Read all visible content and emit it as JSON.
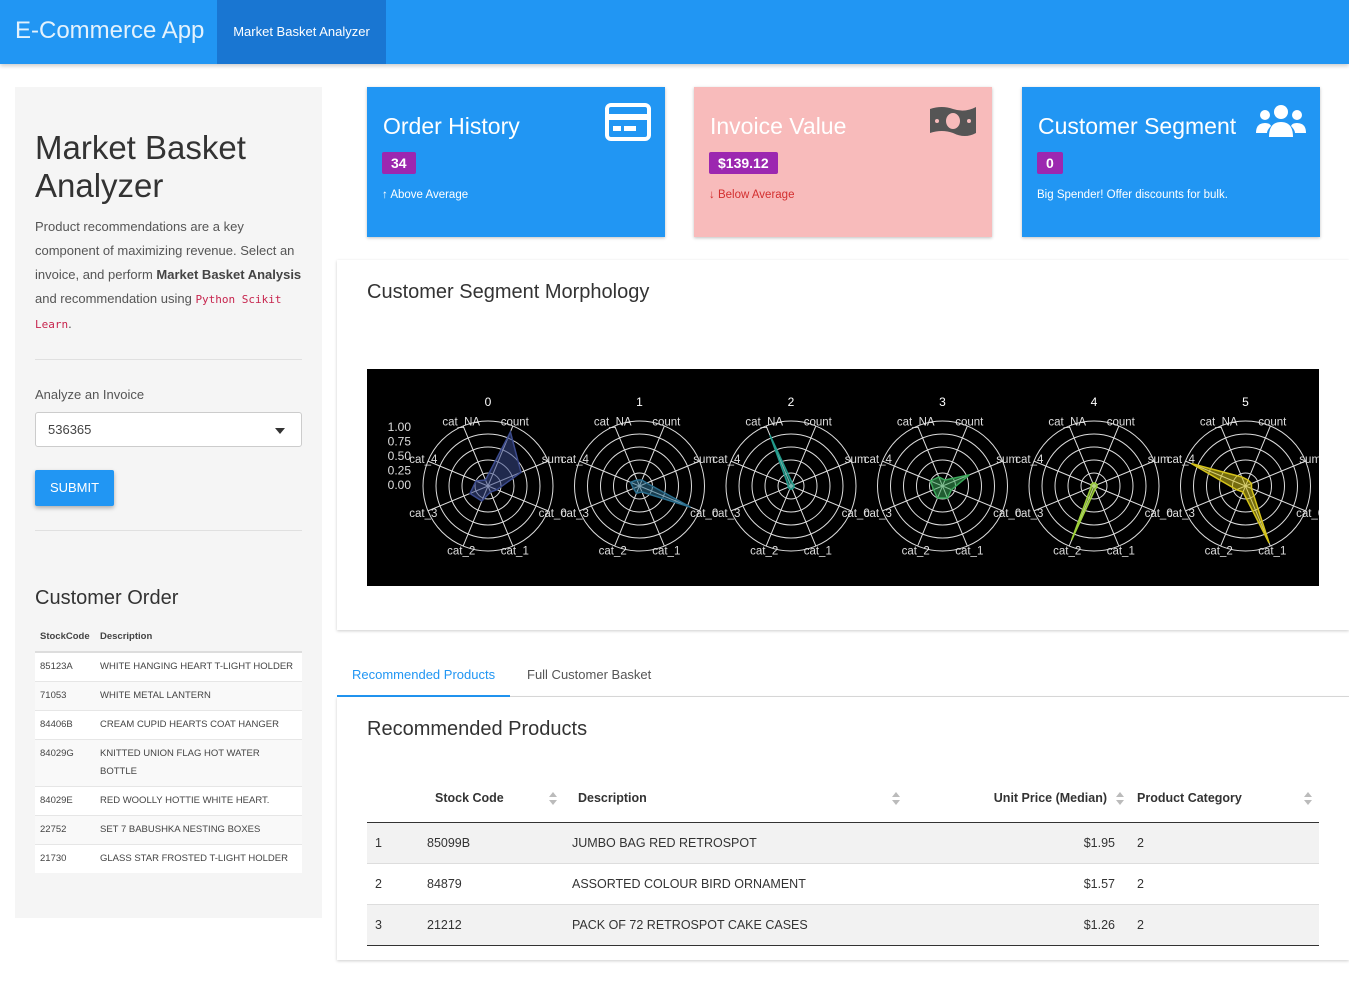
{
  "navbar": {
    "brand": "E-Commerce App",
    "tab": "Market Basket Analyzer",
    "color": "#2196f3"
  },
  "sidebar": {
    "title": "Market Basket Analyzer",
    "desc_1": "Product recommendations are a key component of maximizing revenue. Select an invoice, and perform ",
    "desc_bold": "Market Basket Analysis",
    "desc_2": " and recommendation using ",
    "desc_code": "Python Scikit Learn",
    "desc_3": ".",
    "select_label": "Analyze an Invoice",
    "select_value": "536365",
    "submit_label": "SUBMIT",
    "order_title": "Customer Order",
    "order_columns": [
      "StockCode",
      "Description"
    ],
    "order_rows": [
      [
        "85123A",
        "WHITE HANGING HEART T-LIGHT HOLDER"
      ],
      [
        "71053",
        "WHITE METAL LANTERN"
      ],
      [
        "84406B",
        "CREAM CUPID HEARTS COAT HANGER"
      ],
      [
        "84029G",
        "KNITTED UNION FLAG HOT WATER BOTTLE"
      ],
      [
        "84029E",
        "RED WOOLLY HOTTIE WHITE HEART."
      ],
      [
        "22752",
        "SET 7 BABUSHKA NESTING BOXES"
      ],
      [
        "21730",
        "GLASS STAR FROSTED T-LIGHT HOLDER"
      ]
    ]
  },
  "value_boxes": [
    {
      "title": "Order History",
      "value": "34",
      "subtitle": "Above Average",
      "arrow": "↑",
      "icon": "credit-card-icon",
      "bg": "#2196f3",
      "fg": "#ffffff"
    },
    {
      "title": "Invoice Value",
      "value": "$139.12",
      "subtitle": "Below Average",
      "arrow": "↓",
      "icon": "money-bill-icon",
      "bg": "#f8bbbb",
      "fg": "#ffffff"
    },
    {
      "title": "Customer Segment",
      "value": "0",
      "subtitle": "Big Spender! Offer discounts for bulk.",
      "arrow": "",
      "icon": "users-icon",
      "bg": "#2196f3",
      "fg": "#ffffff"
    }
  ],
  "morphology": {
    "title": "Customer Segment Morphology"
  },
  "tabs": [
    "Recommended Products",
    "Full Customer Basket"
  ],
  "recommended": {
    "title": "Recommended Products",
    "columns": [
      "",
      "Stock Code",
      "Description",
      "Unit Price (Median)",
      "Product Category"
    ],
    "rows": [
      [
        "1",
        "85099B",
        "JUMBO BAG RED RETROSPOT",
        "$1.95",
        "2"
      ],
      [
        "2",
        "84879",
        "ASSORTED COLOUR BIRD ORNAMENT",
        "$1.57",
        "2"
      ],
      [
        "3",
        "21212",
        "PACK OF 72 RETROSPOT CAKE CASES",
        "$1.26",
        "2"
      ]
    ]
  },
  "chart_data": {
    "type": "radar",
    "axes": [
      "count",
      "sum",
      "cat_0",
      "cat_1",
      "cat_2",
      "cat_3",
      "cat_4",
      "cat_NA"
    ],
    "radial_ticks": [
      "1.00",
      "0.75",
      "0.50",
      "0.25",
      "0.00"
    ],
    "rlim": [
      0,
      1
    ],
    "panels": [
      {
        "title": "0",
        "color": "#3b4a8c",
        "values": [
          0.9,
          0.55,
          0.15,
          0.1,
          0.25,
          0.3,
          0.2,
          0.1
        ]
      },
      {
        "title": "1",
        "color": "#2b6f8f",
        "values": [
          0.1,
          0.12,
          0.85,
          0.1,
          0.12,
          0.1,
          0.15,
          0.1
        ]
      },
      {
        "title": "2",
        "color": "#22998a",
        "values": [
          0.05,
          0.05,
          0.05,
          0.05,
          0.05,
          0.05,
          0.05,
          0.85
        ]
      },
      {
        "title": "3",
        "color": "#3aa85a",
        "values": [
          0.1,
          0.45,
          0.15,
          0.2,
          0.2,
          0.15,
          0.2,
          0.15
        ]
      },
      {
        "title": "4",
        "color": "#9ccf3a",
        "values": [
          0.05,
          0.05,
          0.05,
          0.05,
          0.9,
          0.05,
          0.05,
          0.05
        ]
      },
      {
        "title": "5",
        "color": "#d4c21a",
        "values": [
          0.1,
          0.1,
          0.1,
          0.95,
          0.1,
          0.15,
          0.9,
          0.15
        ]
      }
    ],
    "grid": true,
    "background": "#000000"
  }
}
